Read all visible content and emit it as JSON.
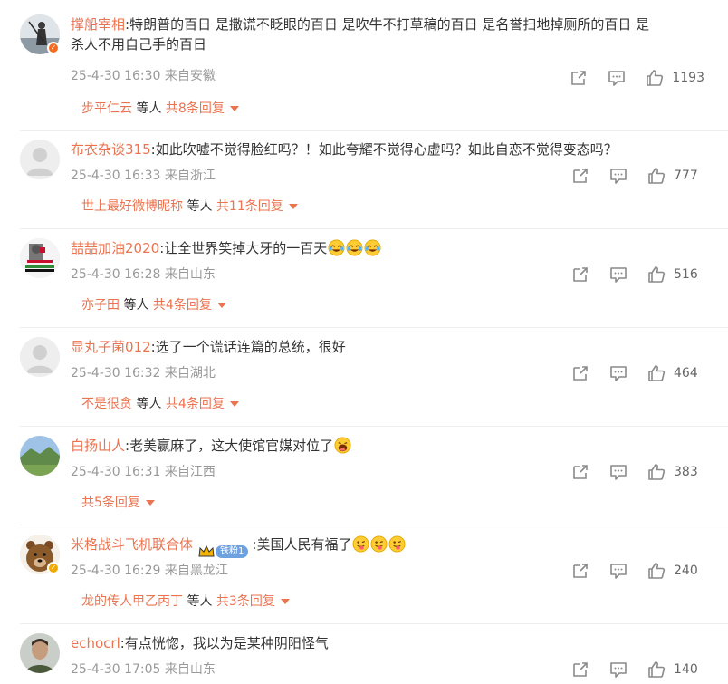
{
  "comments": [
    {
      "user": "撑船宰相",
      "text_lines": [
        ":特朗普的百日 是撒谎不眨眼的百日 是吹牛不打草稿的百日 是名誉扫地掉厕所的百日 是",
        "杀人不用自己手的百日"
      ],
      "time": "25-4-30 16:30",
      "location": "来自安徽",
      "likes": "1193",
      "reply_user": "步平仁云",
      "reply_mid": "等人",
      "reply_count": "共8条回复",
      "avatar": "photo-silhouette",
      "badge": "v-orange"
    },
    {
      "user": "布衣杂谈315",
      "text_lines": [
        ":如此吹嘘不觉得脸红吗？！如此夸耀不觉得心虚吗？如此自恋不觉得变态吗？"
      ],
      "time": "25-4-30 16:33",
      "location": "来自浙江",
      "likes": "777",
      "reply_user": "世上最好微博昵称",
      "reply_mid": "等人",
      "reply_count": "共11条回复",
      "avatar": "default-avatar"
    },
    {
      "user": "喆喆加油2020",
      "text_lines": [
        ":让全世界笑掉大牙的一百天"
      ],
      "emojis": [
        "laugh-cry-emoji",
        "laugh-cry-emoji",
        "laugh-cry-emoji"
      ],
      "time": "25-4-30 16:28",
      "location": "来自山东",
      "likes": "516",
      "reply_user": "亦子田",
      "reply_mid": "等人",
      "reply_count": "共4条回复",
      "avatar": "palestine-poster"
    },
    {
      "user": "显丸子菌012",
      "text_lines": [
        ":选了一个谎话连篇的总统，很好"
      ],
      "time": "25-4-30 16:32",
      "location": "来自湖北",
      "likes": "464",
      "reply_user": "不是很贪",
      "reply_mid": "等人",
      "reply_count": "共4条回复",
      "avatar": "default-avatar"
    },
    {
      "user": "白扬山人",
      "text_lines": [
        ":老美赢麻了，这大使馆官媒对位了"
      ],
      "emojis": [
        "big-laugh-emoji"
      ],
      "time": "25-4-30 16:31",
      "location": "来自江西",
      "likes": "383",
      "reply_count": "共5条回复",
      "avatar": "landscape-photo"
    },
    {
      "user": "米格战斗飞机联合体",
      "fan_label": "铁粉1",
      "text_lines": [
        ":美国人民有福了"
      ],
      "emojis": [
        "silly-tongue-emoji",
        "silly-tongue-emoji",
        "silly-tongue-emoji"
      ],
      "time": "25-4-30 16:29",
      "location": "来自黑龙江",
      "likes": "240",
      "reply_user": "龙的传人甲乙丙丁",
      "reply_mid": "等人",
      "reply_count": "共3条回复",
      "avatar": "bear-cartoon",
      "badge": "v-gold"
    },
    {
      "user": "echocrl",
      "text_lines": [
        ":有点恍惚，我以为是某种阴阳怪气"
      ],
      "time": "25-4-30 17:05",
      "location": "来自山东",
      "likes": "140",
      "avatar": "man-photo"
    }
  ],
  "colors": {
    "username": "#eb7350",
    "meta": "#999999",
    "icon": "#8a8a8a"
  }
}
